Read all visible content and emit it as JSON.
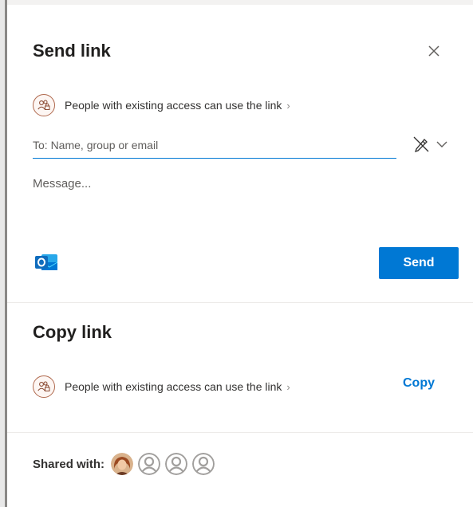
{
  "dialog": {
    "send_title": "Send link",
    "permission_text": "People with existing access can use the link",
    "to_placeholder": "To: Name, group or email",
    "message_placeholder": "Message...",
    "send_label": "Send",
    "copy_title": "Copy link",
    "copy_permission_text": "People with existing access can use the link",
    "copy_label": "Copy",
    "shared_with_label": "Shared with:"
  },
  "icons": {
    "close": "close-icon",
    "permission": "people-lock-icon",
    "chevron": "chevron-right-icon",
    "edit_permission": "pencil-strike-icon",
    "dropdown": "chevron-down-icon",
    "outlook": "outlook-icon",
    "avatar_photo": "user-photo-avatar",
    "avatar_placeholder": "person-placeholder-icon"
  },
  "colors": {
    "accent": "#0078d4",
    "outlook": "#0f6cbd",
    "permission_ring": "#b06a4f"
  }
}
